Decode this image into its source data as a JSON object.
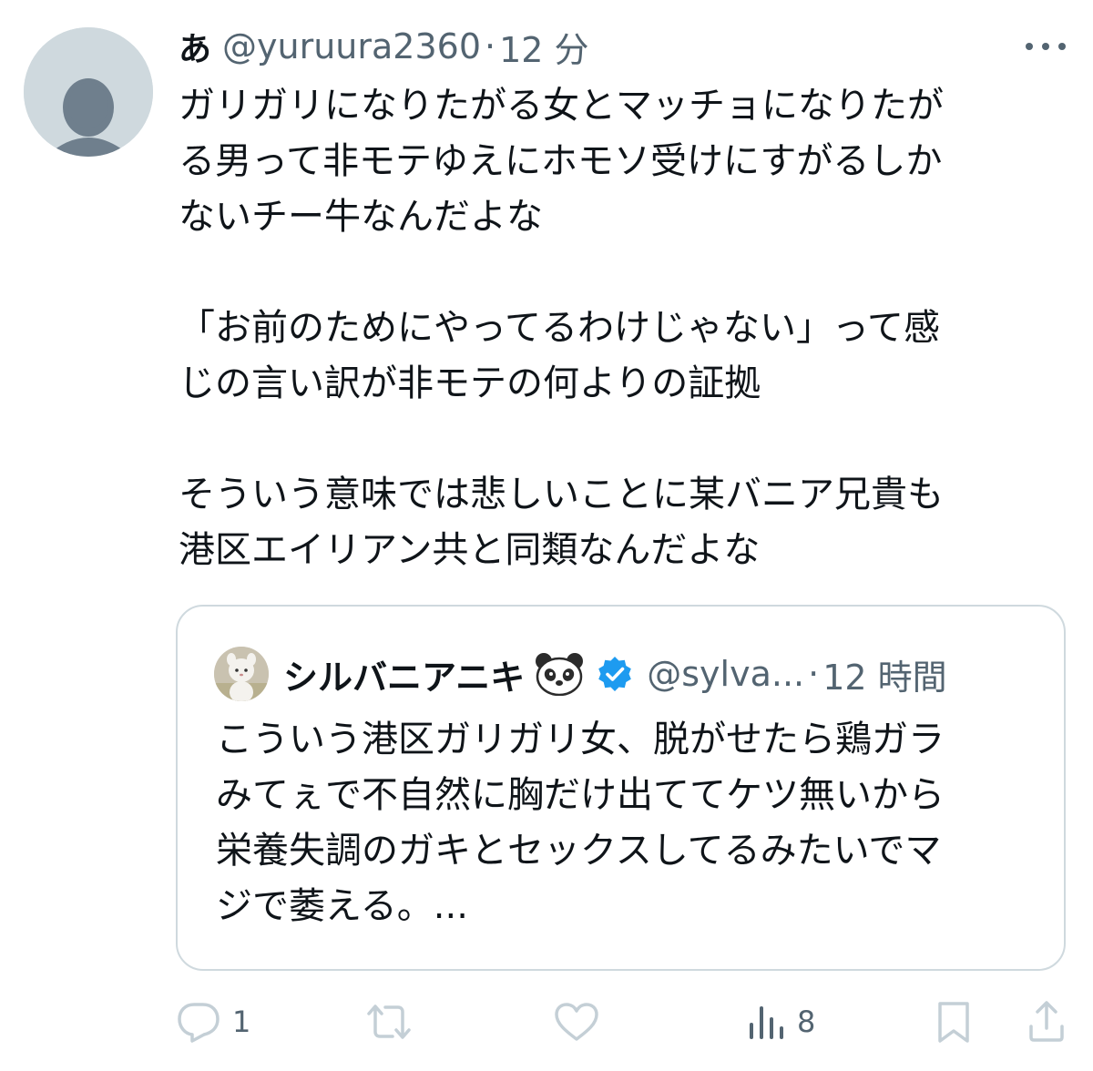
{
  "tweet": {
    "author": {
      "display_name": "あ",
      "handle": "@yuruura2360",
      "separator": "·",
      "time": "12 分"
    },
    "body_paragraphs": [
      [
        "ガリガリになりたがる女とマッチョになりたが",
        "る男って非モテゆえにホモソ受けにすがるしか",
        "ないチー牛なんだよな"
      ],
      [
        "「お前のためにやってるわけじゃない」って感",
        "じの言い訳が非モテの何よりの証拠"
      ],
      [
        "そういう意味では悲しいことに某バニア兄貴も",
        "港区エイリアン共と同類なんだよな"
      ]
    ],
    "more_icon": "more-horizontal-icon"
  },
  "quoted_tweet": {
    "display_name": "シルバニアニキ",
    "emoji": "panda-emoji",
    "verified": true,
    "handle": "@sylva...",
    "separator": "·",
    "time": "12 時間",
    "text_lines": [
      "こういう港区ガリガリ女、脱がせたら鶏ガラ",
      "みてぇで不自然に胸だけ出ててケツ無いから",
      "栄養失調のガキとセックスしてるみたいでマ",
      "ジで萎える。..."
    ]
  },
  "actions": {
    "reply_count": "1",
    "retweet_count": "",
    "like_count": "",
    "views_count": "8"
  },
  "colors": {
    "text_primary": "#0f1419",
    "text_secondary": "#536471",
    "border": "#cfd9de",
    "verified_blue": "#1d9bf0",
    "icon_gray": "#c4cfd6"
  }
}
